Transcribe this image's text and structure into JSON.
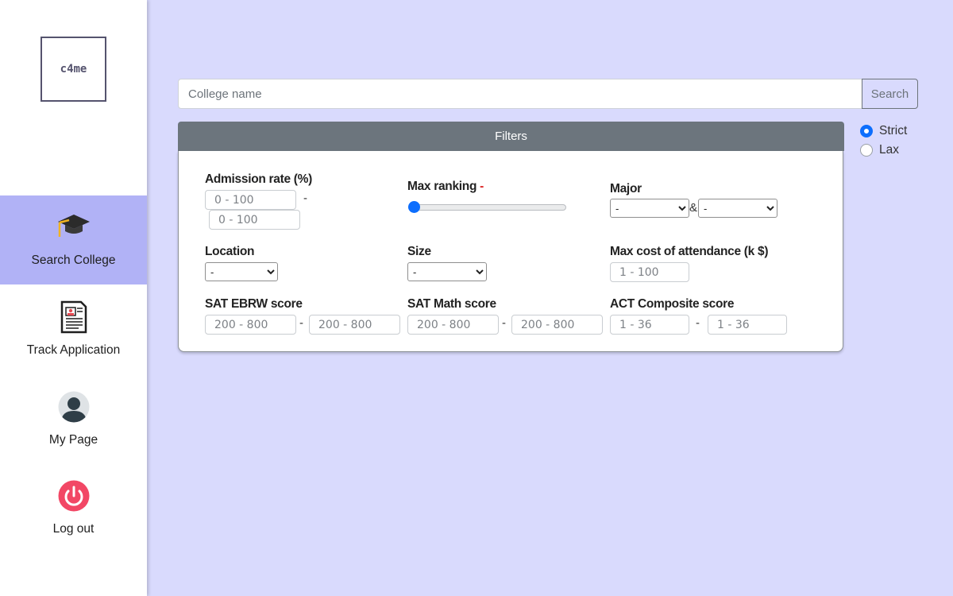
{
  "sidebar": {
    "logo": "c4me",
    "items": [
      {
        "label": "Search College",
        "icon": "graduation-cap-icon",
        "active": true
      },
      {
        "label": "Track Application",
        "icon": "document-icon",
        "active": false
      },
      {
        "label": "My Page",
        "icon": "user-avatar-icon",
        "active": false
      },
      {
        "label": "Log out",
        "icon": "power-icon",
        "active": false
      }
    ]
  },
  "search": {
    "placeholder": "College name",
    "value": "",
    "button_label": "Search"
  },
  "filters": {
    "header": "Filters",
    "admission_rate": {
      "label": "Admission rate (%)",
      "min_placeholder": "0 - 100",
      "max_placeholder": "0 - 100",
      "separator": "-"
    },
    "max_ranking": {
      "label": "Max ranking",
      "value": "-",
      "slider_fraction": 0
    },
    "major": {
      "label": "Major",
      "first": "-",
      "joiner": "&",
      "second": "-"
    },
    "location": {
      "label": "Location",
      "value": "-"
    },
    "size": {
      "label": "Size",
      "value": "-"
    },
    "max_cost": {
      "label": "Max cost of attendance (k $)",
      "placeholder": "1 - 100"
    },
    "sat_ebrw": {
      "label": "SAT EBRW score",
      "min_placeholder": "200 - 800",
      "max_placeholder": "200 - 800",
      "separator": "-"
    },
    "sat_math": {
      "label": "SAT Math score",
      "min_placeholder": "200 - 800",
      "max_placeholder": "200 - 800",
      "separator": "-"
    },
    "act": {
      "label": "ACT Composite score",
      "min_placeholder": "1 - 36",
      "max_placeholder": "1 - 36",
      "separator": "-"
    }
  },
  "match_mode": {
    "options": [
      {
        "label": "Strict",
        "checked": true
      },
      {
        "label": "Lax",
        "checked": false
      }
    ]
  },
  "colors": {
    "page_bg": "#d9dafd",
    "sidebar_active": "#b1b2f6",
    "filters_header": "#6c757d",
    "accent": "#0d6efd",
    "ranking_dash": "#dc2626"
  }
}
